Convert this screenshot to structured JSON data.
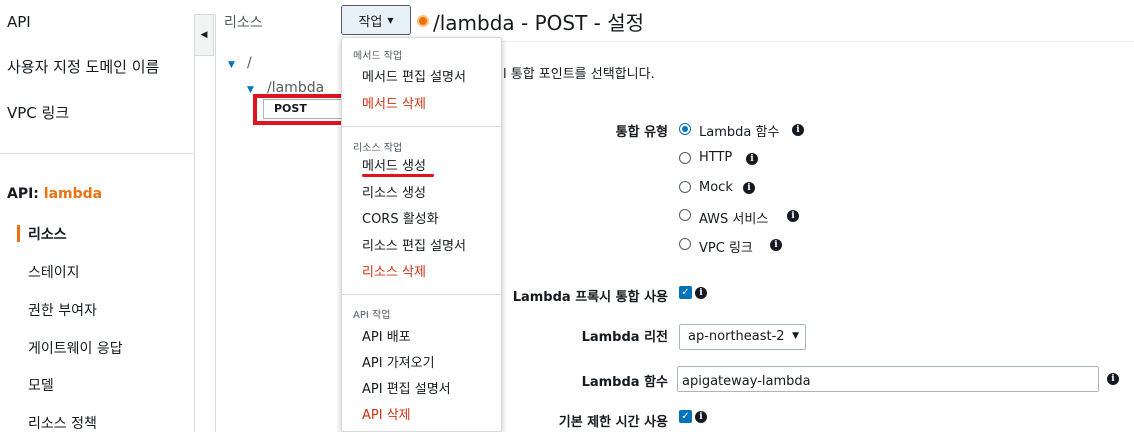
{
  "sidebar": {
    "top_items": [
      "API",
      "사용자 지정 도메인 이름",
      "VPC 링크"
    ],
    "api_prefix": "API:",
    "api_name": "lambda",
    "sub_items": [
      "리소스",
      "스테이지",
      "권한 부여자",
      "게이트웨이 응답",
      "모델",
      "리소스 정책"
    ],
    "active_item": "리소스"
  },
  "resources": {
    "header": "리소스",
    "tree": {
      "root": "/",
      "child": "/lambda",
      "method": "POST"
    }
  },
  "actions_button": {
    "label": "작업"
  },
  "method_title": "/lambda - POST - 설정",
  "dropdown": {
    "sections": [
      {
        "title": "메서드 작업",
        "items": [
          "메서드 편집 설명서",
          "메서드 삭제"
        ]
      },
      {
        "title": "리소스 작업",
        "items": [
          "메서드 생성",
          "리소스 생성",
          "CORS 활성화",
          "리소스 편집 설명서",
          "리소스 삭제"
        ]
      },
      {
        "title": "API 작업",
        "items": [
          "API 배포",
          "API 가져오기",
          "API 편집 설명서",
          "API 삭제"
        ]
      }
    ],
    "danger_color": "#d13212"
  },
  "settings": {
    "intro_suffix": "l 통합 포인트를 선택합니다.",
    "integration_type_label": "통합 유형",
    "integration_options": [
      "Lambda 함수",
      "HTTP",
      "Mock",
      "AWS 서비스",
      "VPC 링크"
    ],
    "integration_selected": "Lambda 함수",
    "proxy_label": "Lambda 프록시 통합 사용",
    "proxy_checked": true,
    "region_label": "Lambda 리전",
    "region_value": "ap-northeast-2",
    "function_label": "Lambda 함수",
    "function_value": "apigateway-lambda",
    "timeout_label": "기본 제한 시간 사용",
    "timeout_checked": true
  },
  "colors": {
    "accent": "#ec7211",
    "link": "#0073bb",
    "highlight": "#e0141e"
  },
  "icons": {
    "info": "info-circle-icon",
    "collapse": "chevron-left-icon",
    "tree_caret": "caret-down-icon"
  }
}
